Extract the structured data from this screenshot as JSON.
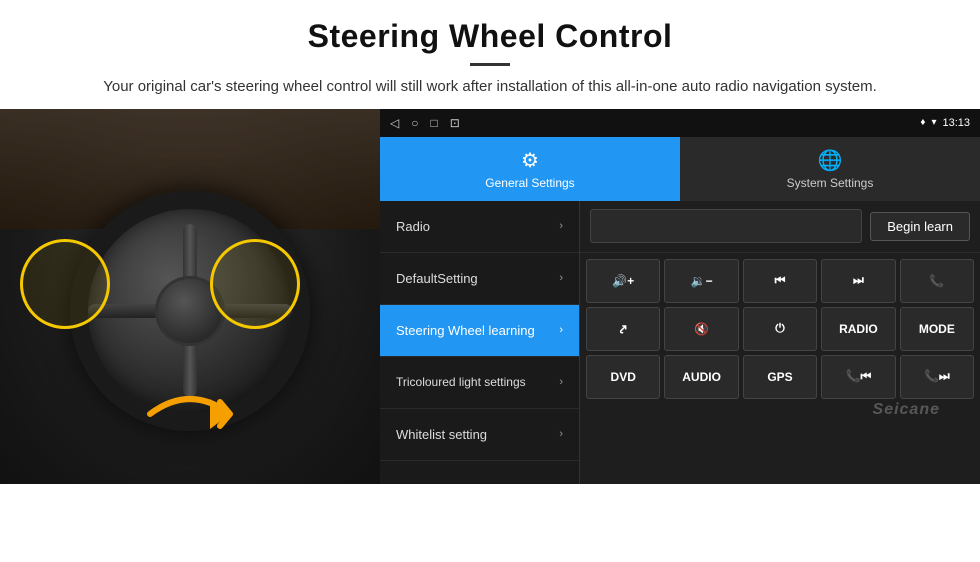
{
  "page": {
    "title": "Steering Wheel Control",
    "divider": true,
    "subtitle": "Your original car's steering wheel control will still work after installation of this all-in-one auto radio navigation system."
  },
  "status_bar": {
    "nav_icons": [
      "◁",
      "○",
      "□",
      "⊡"
    ],
    "time": "13:13",
    "signal_icon": "♦",
    "wifi_icon": "▾"
  },
  "tabs": [
    {
      "id": "general",
      "label": "General Settings",
      "active": true
    },
    {
      "id": "system",
      "label": "System Settings",
      "active": false
    }
  ],
  "menu_items": [
    {
      "id": "radio",
      "label": "Radio",
      "active": false
    },
    {
      "id": "default",
      "label": "DefaultSetting",
      "active": false
    },
    {
      "id": "steering",
      "label": "Steering Wheel learning",
      "active": true
    },
    {
      "id": "tricoloured",
      "label": "Tricoloured light settings",
      "active": false
    },
    {
      "id": "whitelist",
      "label": "Whitelist setting",
      "active": false
    }
  ],
  "right_panel": {
    "begin_learn_label": "Begin learn",
    "button_rows": [
      [
        {
          "id": "vol_up",
          "label": "🔊+",
          "type": "icon"
        },
        {
          "id": "vol_down",
          "label": "🔉−",
          "type": "icon"
        },
        {
          "id": "prev",
          "label": "⏮",
          "type": "icon"
        },
        {
          "id": "next",
          "label": "⏭",
          "type": "icon"
        },
        {
          "id": "phone",
          "label": "📞",
          "type": "icon"
        }
      ],
      [
        {
          "id": "hang",
          "label": "↩",
          "type": "icon"
        },
        {
          "id": "mute",
          "label": "🔇×",
          "type": "icon"
        },
        {
          "id": "power",
          "label": "⏻",
          "type": "icon"
        },
        {
          "id": "radio_btn",
          "label": "RADIO",
          "type": "text"
        },
        {
          "id": "mode",
          "label": "MODE",
          "type": "text"
        }
      ],
      [
        {
          "id": "dvd",
          "label": "DVD",
          "type": "text"
        },
        {
          "id": "audio",
          "label": "AUDIO",
          "type": "text"
        },
        {
          "id": "gps",
          "label": "GPS",
          "type": "text"
        },
        {
          "id": "tel_prev",
          "label": "📞⏮",
          "type": "icon"
        },
        {
          "id": "tel_next",
          "label": "📞⏭",
          "type": "icon"
        }
      ]
    ]
  },
  "watermark": "Seicane"
}
